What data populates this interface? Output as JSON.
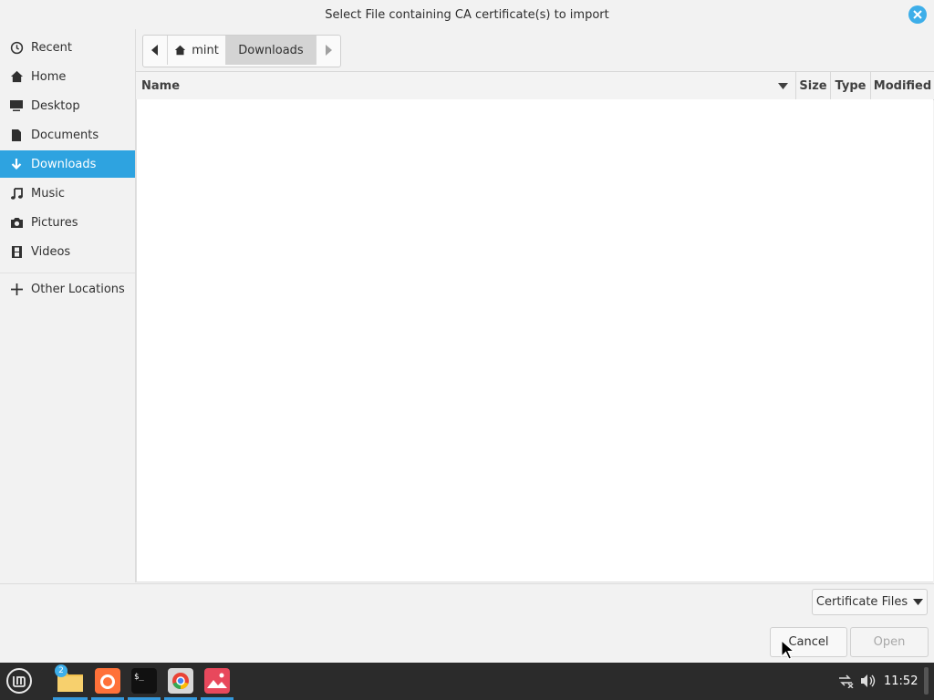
{
  "window": {
    "title": "Select File containing CA certificate(s) to import"
  },
  "sidebar": {
    "items": [
      {
        "label": "Recent",
        "icon": "clock-icon"
      },
      {
        "label": "Home",
        "icon": "home-icon"
      },
      {
        "label": "Desktop",
        "icon": "desktop-icon"
      },
      {
        "label": "Documents",
        "icon": "document-icon"
      },
      {
        "label": "Downloads",
        "icon": "download-icon",
        "active": true
      },
      {
        "label": "Music",
        "icon": "music-icon"
      },
      {
        "label": "Pictures",
        "icon": "camera-icon"
      },
      {
        "label": "Videos",
        "icon": "film-icon"
      },
      {
        "label": "Other Locations",
        "icon": "plus-icon"
      }
    ]
  },
  "pathbar": {
    "segments": [
      "mint",
      "Downloads"
    ]
  },
  "columns": {
    "name": "Name",
    "size": "Size",
    "type": "Type",
    "modified": "Modified"
  },
  "filter": {
    "label": "Certificate Files"
  },
  "buttons": {
    "cancel": "Cancel",
    "open": "Open"
  },
  "taskbar": {
    "badge": "2",
    "clock": "11:52",
    "accent": "#3598db"
  },
  "colors": {
    "accent": "#2ea3e0"
  }
}
